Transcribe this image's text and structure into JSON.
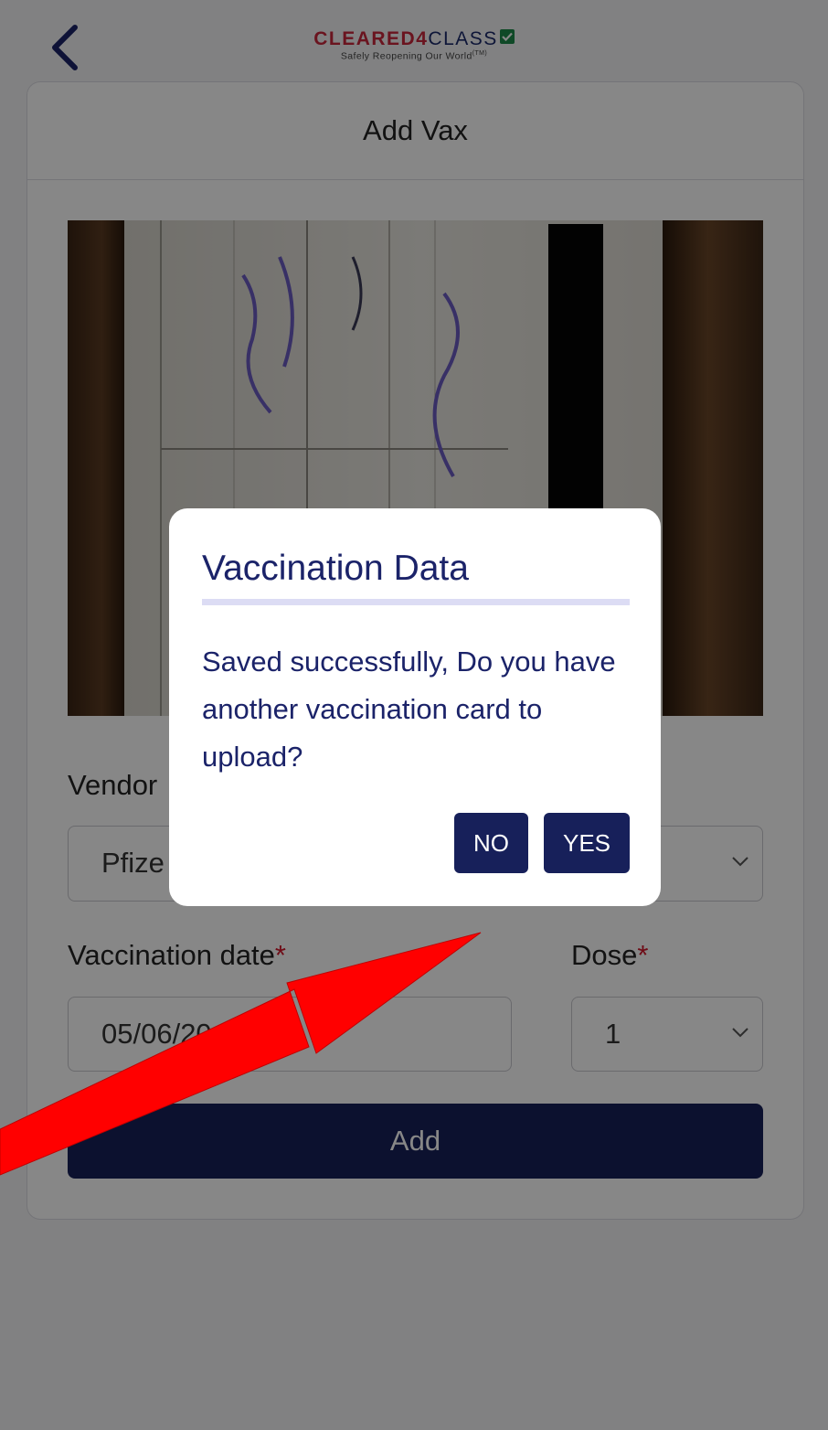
{
  "header": {
    "logo_brand_red": "CLEARED4",
    "logo_brand_navy": "CLASS",
    "logo_tagline": "Safely Reopening Our World",
    "logo_tm": "(TM)"
  },
  "page": {
    "title": "Add Vax"
  },
  "form": {
    "vendor_label": "Vendor",
    "vendor_value": "Pfize",
    "date_label": "Vaccination date",
    "date_value": "05/06/20",
    "dose_label": "Dose",
    "dose_value": "1",
    "required_mark": "*",
    "add_label": "Add"
  },
  "dialog": {
    "title": "Vaccination Data",
    "message": "Saved successfully, Do you have another vaccination card to upload?",
    "no_label": "NO",
    "yes_label": "YES"
  },
  "colors": {
    "navy": "#17205a",
    "accent_red": "#c8263c",
    "required_red": "#d1162a",
    "annotation_arrow": "#ff0000"
  },
  "icons": [
    "back-arrow-icon",
    "check-icon",
    "chevron-down-icon"
  ]
}
